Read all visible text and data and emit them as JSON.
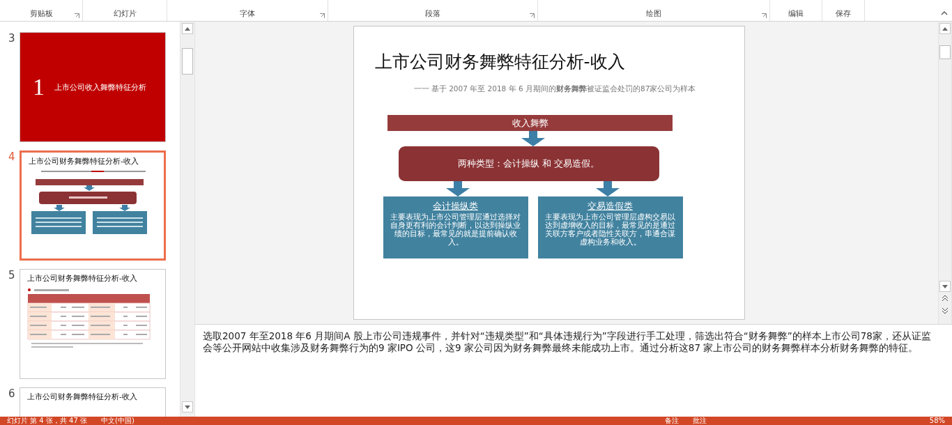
{
  "ribbon_groups": [
    {
      "label": "剪贴板",
      "launcher": true
    },
    {
      "label": "幻灯片",
      "launcher": false
    },
    {
      "label": "字体",
      "launcher": true
    },
    {
      "label": "段落",
      "launcher": true
    },
    {
      "label": "绘图",
      "launcher": true
    },
    {
      "label": "编辑",
      "launcher": false
    },
    {
      "label": "保存",
      "launcher": false
    }
  ],
  "thumbnails": [
    {
      "number": "3",
      "selected": false,
      "kind": "section",
      "numeral": "1",
      "title": "上市公司收入舞弊特征分析"
    },
    {
      "number": "4",
      "selected": true,
      "kind": "diagram",
      "title": "上市公司财务舞弊特征分析-收入"
    },
    {
      "number": "5",
      "selected": false,
      "kind": "table",
      "title": "上市公司财务舞弊特征分析-收入"
    },
    {
      "number": "6",
      "selected": false,
      "kind": "title_only",
      "title": "上市公司财务舞弊特征分析-收入"
    }
  ],
  "current_slide": {
    "title": "上市公司财务舞弊特征分析-收入",
    "subtitle": "一一  基于 2007 年至 2018 年 6  月期间的**财务舞弊**被证监会处罚的87家公司为样本",
    "top_bar": "收入舞弊",
    "summary": "两种类型：会计操纵 和 交易造假。",
    "categories": [
      {
        "heading": "会计操纵类",
        "body": "主要表现为上市公司管理层通过选择对自身更有利的会计判断，以达到操纵业绩的目标，最常见的就是提前确认收入。"
      },
      {
        "heading": "交易造假类",
        "body": "主要表现为上市公司管理层虚构交易以达到虚增收入的目标，最常见的是通过关联方客户或者隐性关联方，串通合谋虚构业务和收入。"
      }
    ]
  },
  "notes": "选取2007 年至2018 年6 月期间A 股上市公司违规事件，并针对“违规类型”和“具体违规行为”字段进行手工处理，筛选出符合“财务舞弊”的样本上市公司78家，还从证监会等公开网站中收集涉及财务舞弊行为的9 家IPO 公司，这9 家公司因为财务舞弊最终未能成功上市。通过分析这87 家上市公司的财务舞弊样本分析财务舞弊的特征。",
  "status_bar": {
    "slide_info": "幻灯片 第 4 张，共 47 张",
    "language": "中文(中国)",
    "notes_button": "备注",
    "comments_button": "批注",
    "zoom": "58%"
  }
}
